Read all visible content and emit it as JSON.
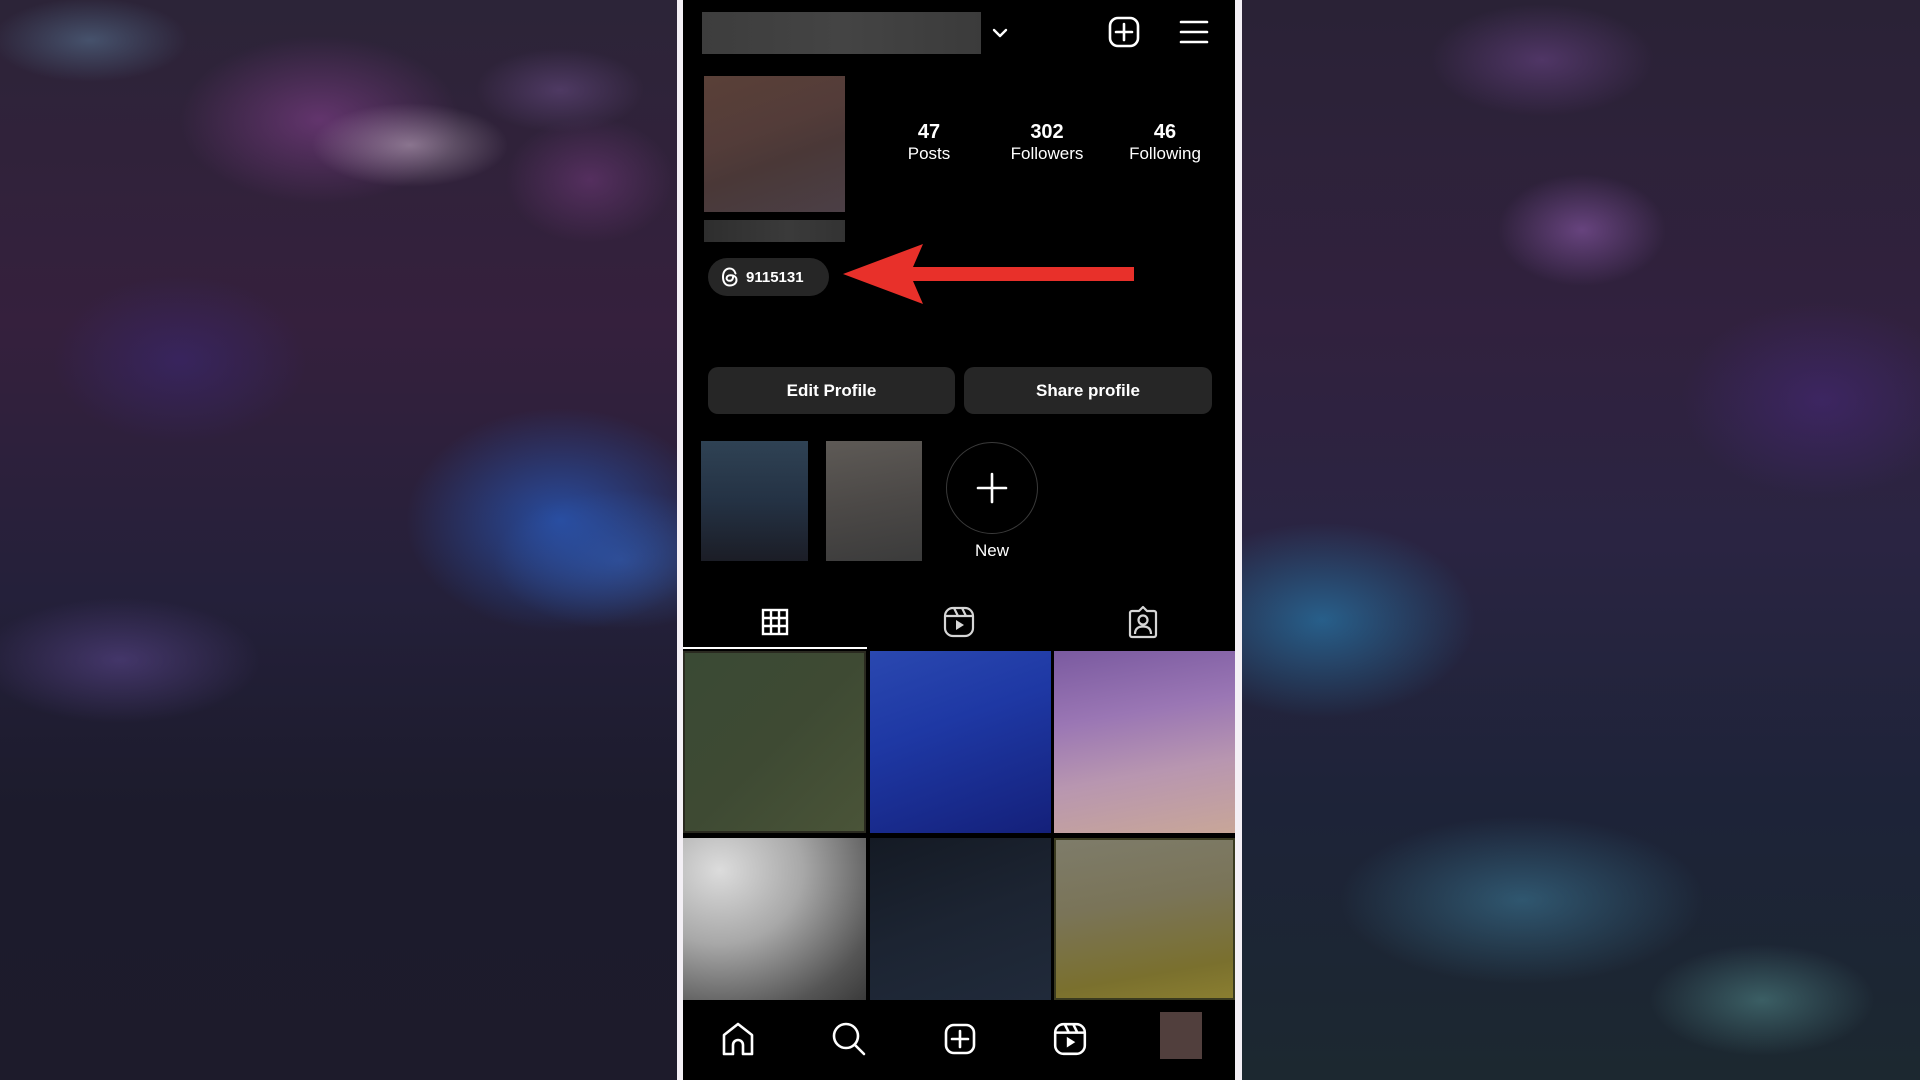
{
  "header": {
    "username": "",
    "add_label": "Create",
    "menu_label": "Menu"
  },
  "profile": {
    "stats": [
      {
        "value": "47",
        "label": "Posts"
      },
      {
        "value": "302",
        "label": "Followers"
      },
      {
        "value": "46",
        "label": "Following"
      }
    ],
    "threads_badge": "9115131",
    "edit_button": "Edit Profile",
    "share_button": "Share profile"
  },
  "highlights": {
    "new_label": "New"
  },
  "tabs": [
    {
      "name": "grid",
      "icon": "grid-icon",
      "active": true
    },
    {
      "name": "reels",
      "icon": "reels-icon",
      "active": false
    },
    {
      "name": "tagged",
      "icon": "tagged-icon",
      "active": false
    }
  ],
  "bottom_nav": [
    {
      "name": "home",
      "icon": "home-icon"
    },
    {
      "name": "search",
      "icon": "search-icon"
    },
    {
      "name": "create",
      "icon": "plus-square-icon"
    },
    {
      "name": "reels",
      "icon": "reels-icon"
    },
    {
      "name": "profile",
      "icon": "avatar"
    }
  ],
  "annotation": {
    "arrow_color": "#e8302a"
  }
}
